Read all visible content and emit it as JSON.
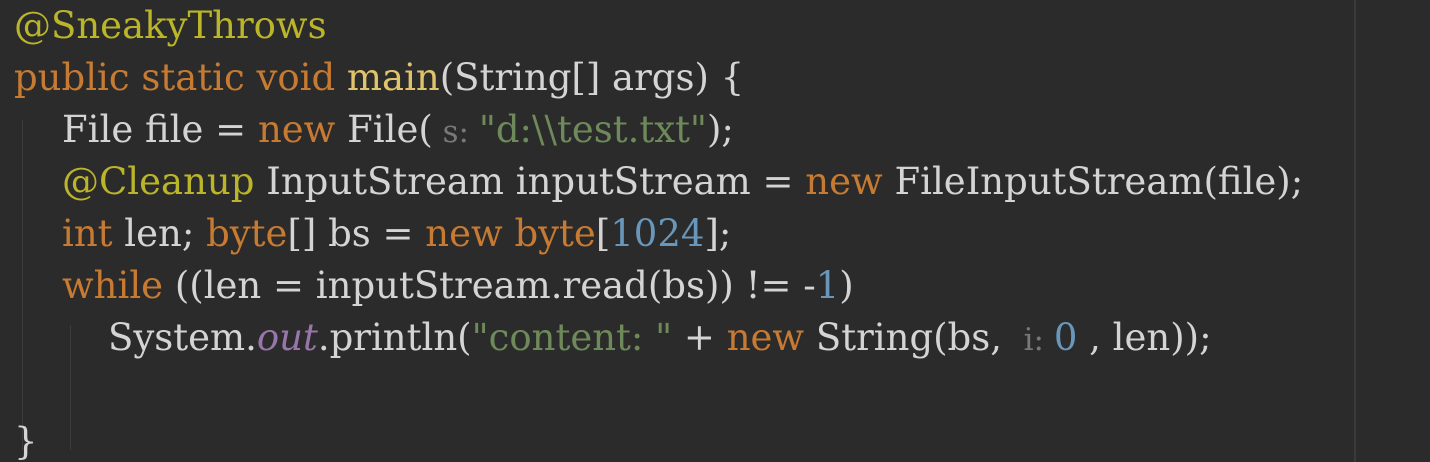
{
  "editor": {
    "lines": [
      {
        "tokens": [
          {
            "text": "@SneakyThrows",
            "kind": "anno"
          }
        ]
      },
      {
        "tokens": [
          {
            "text": "public static void ",
            "kind": "kw"
          },
          {
            "text": "main",
            "kind": "method"
          },
          {
            "text": "(String[] args) {",
            "kind": "plain"
          }
        ]
      },
      {
        "tokens": [
          {
            "text": "File file = ",
            "kind": "plain"
          },
          {
            "text": "new ",
            "kind": "kw"
          },
          {
            "text": "File(",
            "kind": "plain"
          },
          {
            "text": " s: ",
            "kind": "hint"
          },
          {
            "text": "\"d:\\\\test.txt\"",
            "kind": "str"
          },
          {
            "text": ");",
            "kind": "plain"
          }
        ]
      },
      {
        "tokens": [
          {
            "text": "@Cleanup ",
            "kind": "anno"
          },
          {
            "text": "InputStream inputStream = ",
            "kind": "plain"
          },
          {
            "text": "new ",
            "kind": "kw"
          },
          {
            "text": "FileInputStream(file);",
            "kind": "plain"
          }
        ]
      },
      {
        "tokens": [
          {
            "text": "int ",
            "kind": "kw"
          },
          {
            "text": "len; ",
            "kind": "plain"
          },
          {
            "text": "byte",
            "kind": "kw"
          },
          {
            "text": "[] bs = ",
            "kind": "plain"
          },
          {
            "text": "new ",
            "kind": "kw"
          },
          {
            "text": "byte",
            "kind": "kw"
          },
          {
            "text": "[",
            "kind": "plain"
          },
          {
            "text": "1024",
            "kind": "num"
          },
          {
            "text": "];",
            "kind": "plain"
          }
        ]
      },
      {
        "tokens": [
          {
            "text": "while ",
            "kind": "kw"
          },
          {
            "text": "((len = inputStream.read(bs)) != -",
            "kind": "plain"
          },
          {
            "text": "1",
            "kind": "num"
          },
          {
            "text": ")",
            "kind": "plain"
          }
        ]
      },
      {
        "tokens": [
          {
            "text": "System.",
            "kind": "plain"
          },
          {
            "text": "out",
            "kind": "italic"
          },
          {
            "text": ".println(",
            "kind": "plain"
          },
          {
            "text": "\"content: \"",
            "kind": "str"
          },
          {
            "text": " + ",
            "kind": "plain"
          },
          {
            "text": "new ",
            "kind": "kw"
          },
          {
            "text": "String(bs, ",
            "kind": "plain"
          },
          {
            "text": " i: ",
            "kind": "hint"
          },
          {
            "text": "0",
            "kind": "num"
          },
          {
            "text": " , len));",
            "kind": "plain"
          }
        ]
      },
      {
        "tokens": []
      },
      {
        "tokens": [
          {
            "text": "}",
            "kind": "plain"
          }
        ]
      }
    ]
  }
}
